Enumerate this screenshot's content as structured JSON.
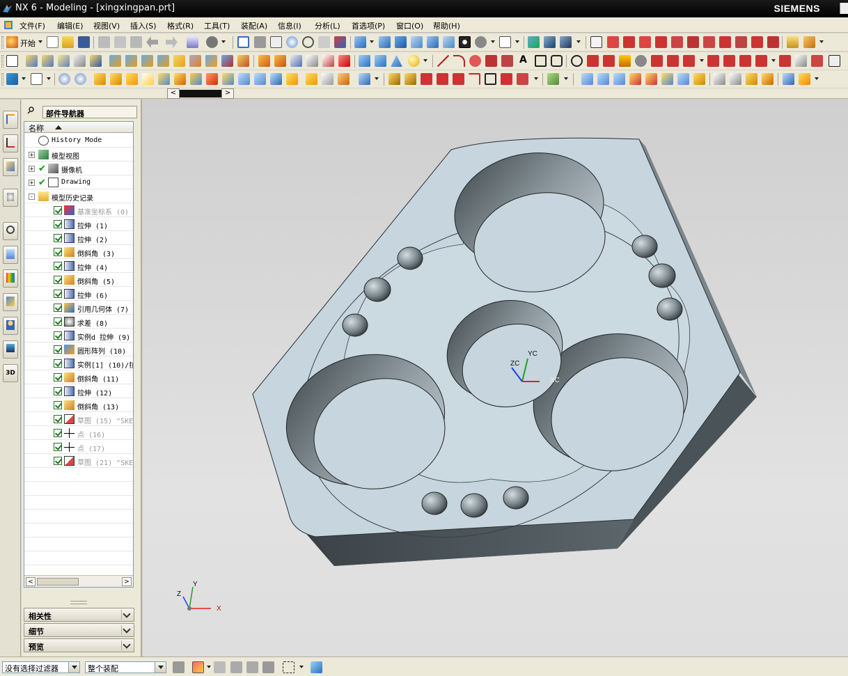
{
  "window": {
    "title": "NX 6 - Modeling - [xingxingpan.prt]",
    "brand": "SIEMENS"
  },
  "menu": {
    "items": [
      "文件(F)",
      "编辑(E)",
      "视图(V)",
      "插入(S)",
      "格式(R)",
      "工具(T)",
      "装配(A)",
      "信息(I)",
      "分析(L)",
      "首选项(P)",
      "窗口(O)",
      "帮助(H)"
    ]
  },
  "toolbar": {
    "start_label": "开始"
  },
  "navigator": {
    "title": "部件导航器",
    "column_name": "名称",
    "nodes": [
      {
        "label": "History Mode",
        "indent": 1,
        "kind": "clock",
        "gray": false
      },
      {
        "label": "模型视图",
        "indent": 0,
        "kind": "view",
        "gray": false,
        "expander": "+"
      },
      {
        "label": "摄像机",
        "indent": 0,
        "kind": "camera",
        "gray": false,
        "expander": "+",
        "bigcheck": true
      },
      {
        "label": "Drawing",
        "indent": 0,
        "kind": "drawing",
        "gray": false,
        "expander": "+",
        "bigcheck": true
      },
      {
        "label": "模型历史记录",
        "indent": 0,
        "kind": "folder",
        "gray": false,
        "expander": "-"
      },
      {
        "label": "基准坐标系 (0)",
        "indent": 2,
        "kind": "csys",
        "gray": true,
        "check": true
      },
      {
        "label": "拉伸 (1)",
        "indent": 2,
        "kind": "extrude",
        "gray": false,
        "check": true
      },
      {
        "label": "拉伸 (2)",
        "indent": 2,
        "kind": "extrude",
        "gray": false,
        "check": true
      },
      {
        "label": "倒斜角 (3)",
        "indent": 2,
        "kind": "chamfer",
        "gray": false,
        "check": true
      },
      {
        "label": "拉伸 (4)",
        "indent": 2,
        "kind": "extrude",
        "gray": false,
        "check": true
      },
      {
        "label": "倒斜角 (5)",
        "indent": 2,
        "kind": "chamfer",
        "gray": false,
        "check": true
      },
      {
        "label": "拉伸 (6)",
        "indent": 2,
        "kind": "extrude",
        "gray": false,
        "check": true
      },
      {
        "label": "引用几何体 (7)",
        "indent": 2,
        "kind": "ref",
        "gray": false,
        "check": true
      },
      {
        "label": "求差 (8)",
        "indent": 2,
        "kind": "subtract",
        "gray": false,
        "check": true
      },
      {
        "label": "实例d 拉伸 (9)",
        "indent": 2,
        "kind": "extrude",
        "gray": false,
        "check": true
      },
      {
        "label": "圆形阵列 (10)",
        "indent": 2,
        "kind": "pattern",
        "gray": false,
        "check": true
      },
      {
        "label": "实例[1] (10)/拉",
        "indent": 2,
        "kind": "extrude",
        "gray": false,
        "check": true
      },
      {
        "label": "倒斜角 (11)",
        "indent": 2,
        "kind": "chamfer",
        "gray": false,
        "check": true
      },
      {
        "label": "拉伸 (12)",
        "indent": 2,
        "kind": "extrude",
        "gray": false,
        "check": true
      },
      {
        "label": "倒斜角 (13)",
        "indent": 2,
        "kind": "chamfer",
        "gray": false,
        "check": true
      },
      {
        "label": "草图 (15) \"SKE",
        "indent": 2,
        "kind": "sketch",
        "gray": true,
        "check": true
      },
      {
        "label": "点 (16)",
        "indent": 2,
        "kind": "point",
        "gray": true,
        "check": true
      },
      {
        "label": "点 (17)",
        "indent": 2,
        "kind": "point",
        "gray": true,
        "check": true
      },
      {
        "label": "草图 (21) \"SKE",
        "indent": 2,
        "kind": "sketch",
        "gray": true,
        "check": true
      }
    ],
    "panels": [
      "相关性",
      "细节",
      "预览"
    ]
  },
  "viewport": {
    "wcs": {
      "x": "XC",
      "y": "YC",
      "z": "ZC"
    },
    "triad": {
      "x": "X",
      "y": "Y",
      "z": "Z"
    }
  },
  "statusbar": {
    "filter_value": "没有选择过滤器",
    "scope_value": "整个装配"
  },
  "colors": {
    "part_top": "#c6d5de",
    "part_side": "#4a5257",
    "part_wall": "#6f7a80"
  }
}
